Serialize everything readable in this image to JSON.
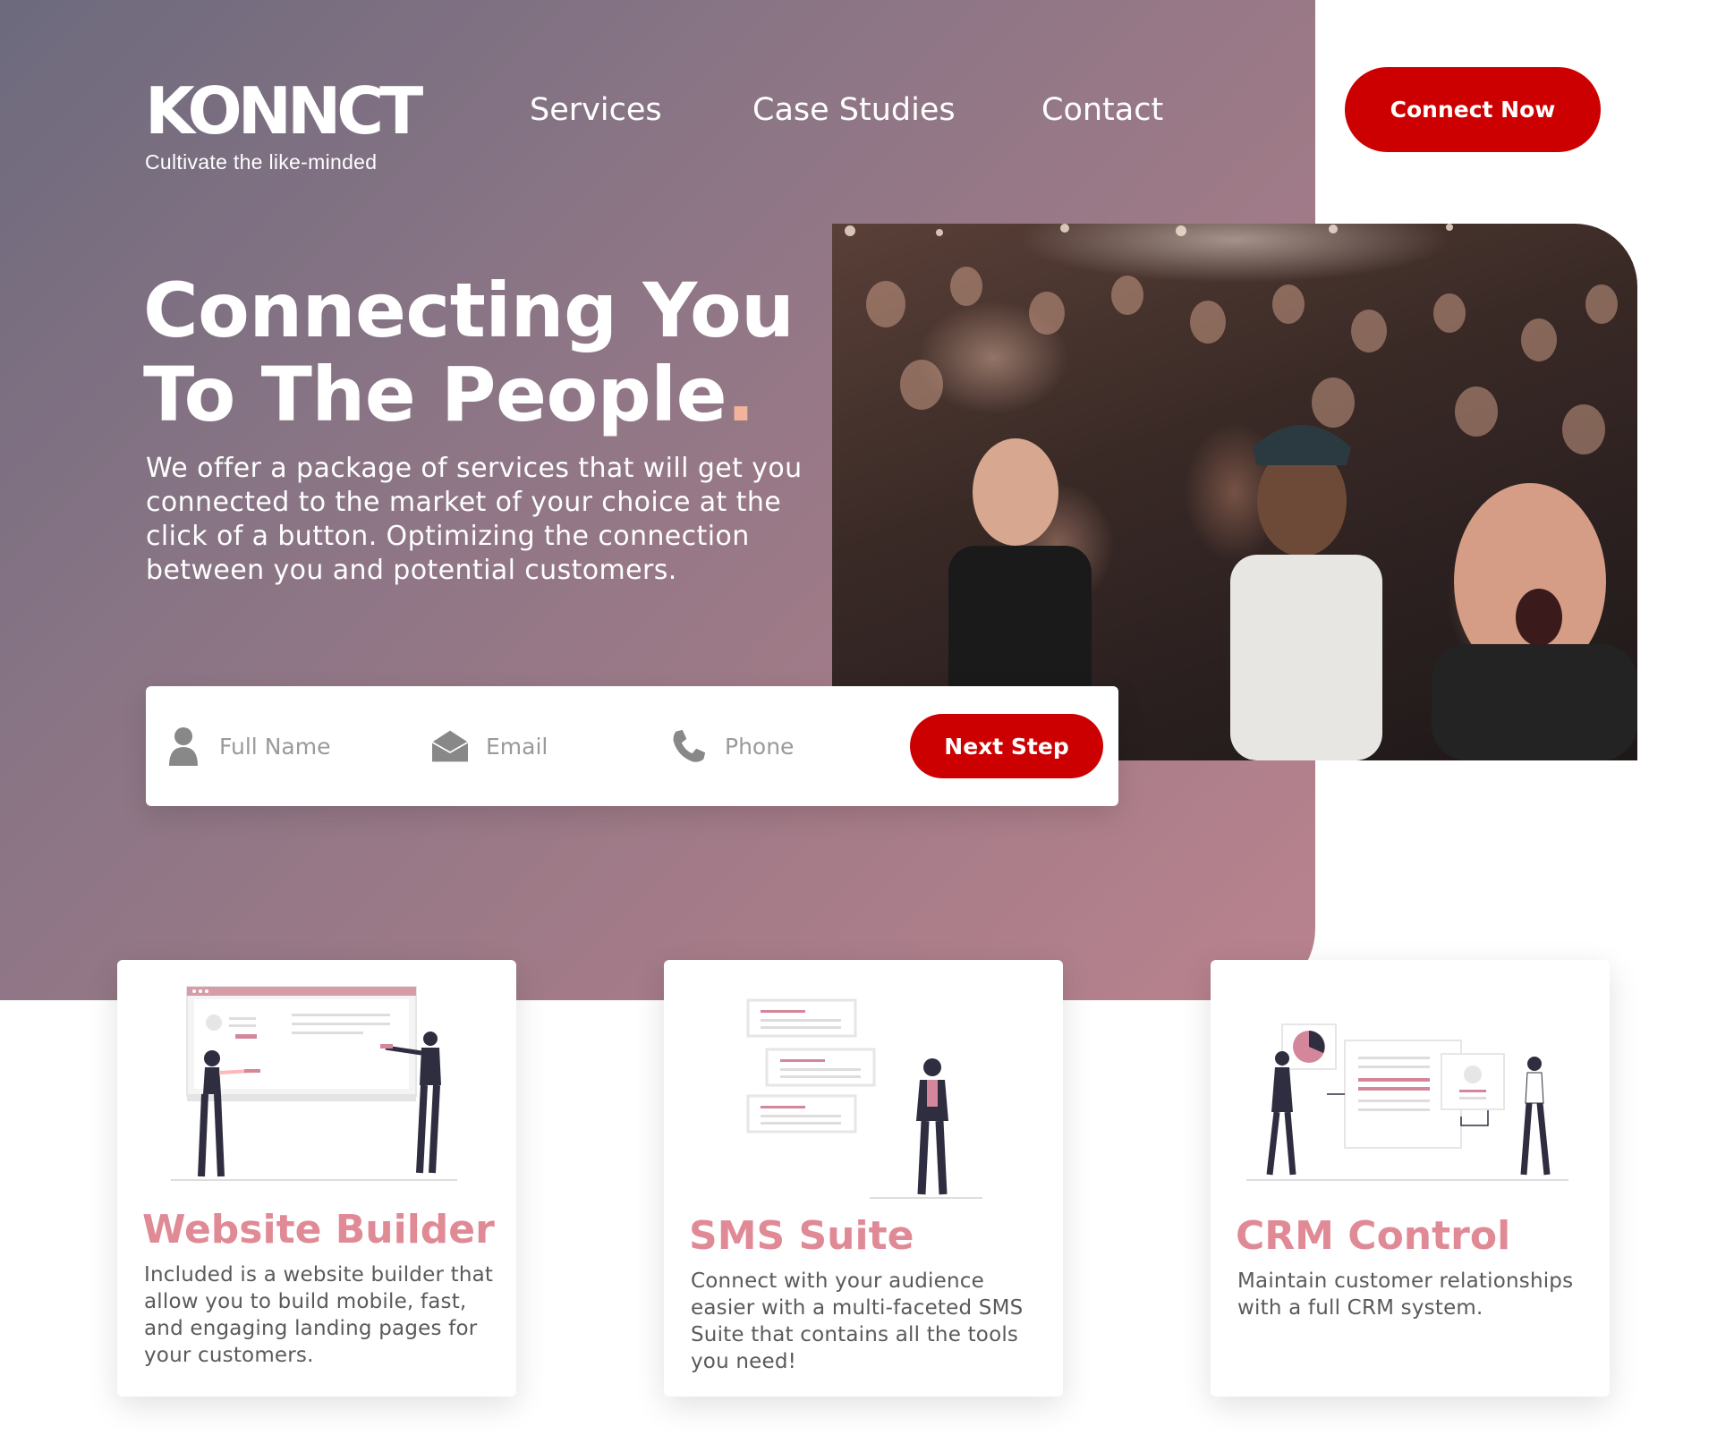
{
  "brand": {
    "logo": "KONNCT",
    "tagline": "Cultivate the like-minded"
  },
  "nav": {
    "items": [
      "Services",
      "Case Studies",
      "Contact"
    ],
    "cta": "Connect Now"
  },
  "hero": {
    "headline_line1": "Connecting You",
    "headline_line2": "To The People",
    "headline_dot": ".",
    "subtext": "We offer a package of services that will get you connected to the market of your choice at the click of a button. Optimizing the connection between you and potential customers."
  },
  "signup_form": {
    "name_placeholder": "Full Name",
    "email_placeholder": "Email",
    "phone_placeholder": "Phone",
    "submit_label": "Next Step"
  },
  "services": [
    {
      "title": "Website Builder",
      "description": "Included is a website builder that allow you to build mobile, fast, and engaging landing pages for your customers."
    },
    {
      "title": "SMS Suite",
      "description": "Connect with your audience easier with a multi-faceted SMS Suite that contains all the tools you need!"
    },
    {
      "title": "CRM Control",
      "description": "Maintain customer relationships with a full CRM system."
    }
  ],
  "colors": {
    "accent_red": "#cc0000",
    "card_title_pink": "#e08a96",
    "hero_gradient_start": "#6d6a7d",
    "hero_gradient_end": "#b9838e",
    "headline_dot": "#f3b39b"
  },
  "icons": [
    "user-icon",
    "envelope-icon",
    "phone-icon"
  ]
}
